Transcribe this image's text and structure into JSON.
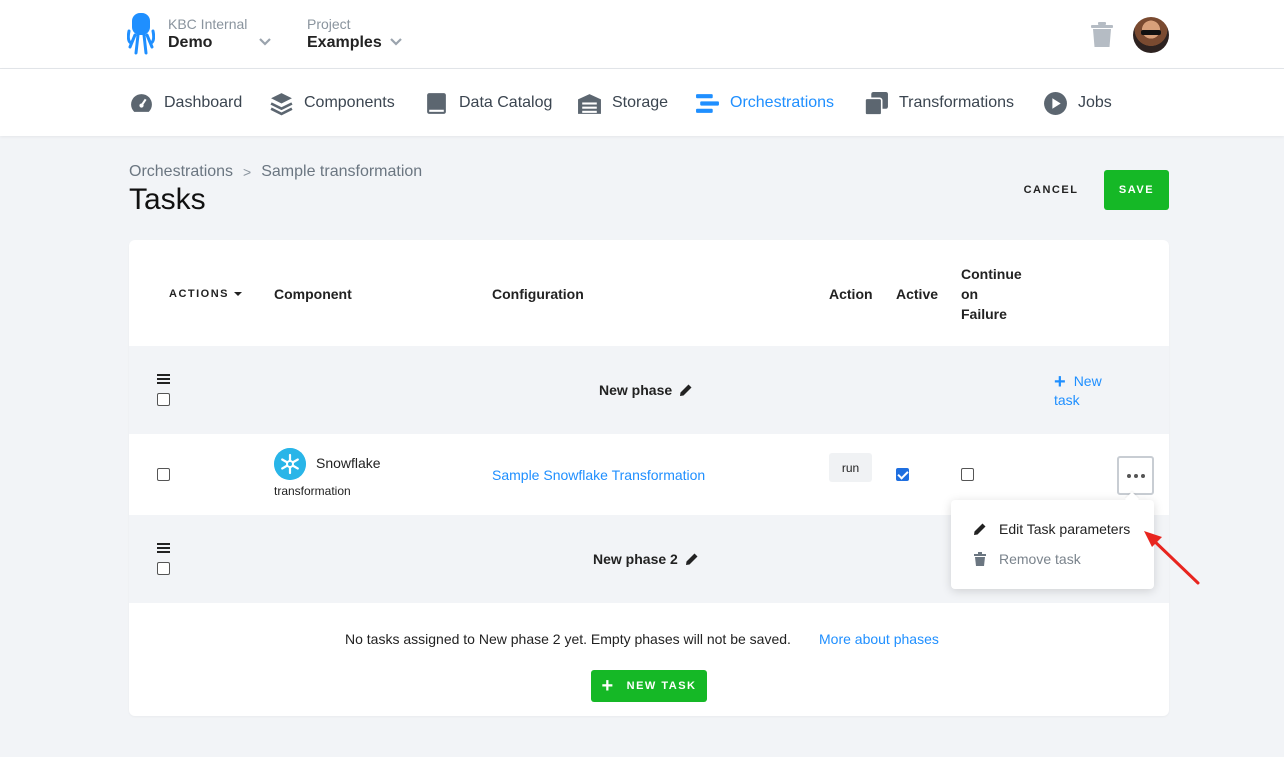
{
  "header": {
    "org_label": "KBC Internal",
    "org_name": "Demo",
    "project_label": "Project",
    "project_name": "Examples"
  },
  "nav": [
    {
      "label": "Dashboard",
      "icon": "dashboard-icon"
    },
    {
      "label": "Components",
      "icon": "components-icon"
    },
    {
      "label": "Data Catalog",
      "icon": "data-catalog-icon"
    },
    {
      "label": "Storage",
      "icon": "storage-icon"
    },
    {
      "label": "Orchestrations",
      "icon": "orchestrations-icon",
      "active": true
    },
    {
      "label": "Transformations",
      "icon": "transformations-icon"
    },
    {
      "label": "Jobs",
      "icon": "jobs-icon"
    }
  ],
  "breadcrumb": {
    "parent": "Orchestrations",
    "sep": ">",
    "current": "Sample transformation"
  },
  "page": {
    "title": "Tasks",
    "cancel_label": "CANCEL",
    "save_label": "SAVE"
  },
  "table": {
    "actions_label": "ACTIONS",
    "headers": {
      "component": "Component",
      "configuration": "Configuration",
      "action": "Action",
      "active": "Active",
      "continue_1": "Continue",
      "continue_2": "on",
      "continue_3": "Failure"
    }
  },
  "phases": [
    {
      "name": "New phase",
      "new_task_1": "New",
      "new_task_2": "task"
    },
    {
      "name": "New phase 2"
    }
  ],
  "task": {
    "component_name": "Snowflake",
    "component_type": "transformation",
    "configuration": "Sample Snowflake Transformation",
    "action": "run",
    "active": true,
    "continue_on_failure": false
  },
  "empty_phase": {
    "message": "No tasks assigned to New phase 2 yet. Empty phases will not be saved.",
    "link": "More about phases",
    "button": "NEW TASK"
  },
  "menu": {
    "edit": "Edit Task parameters",
    "remove": "Remove task"
  },
  "colors": {
    "accent": "#1f8fff",
    "success": "#15b826",
    "annotation": "#e8251f"
  }
}
